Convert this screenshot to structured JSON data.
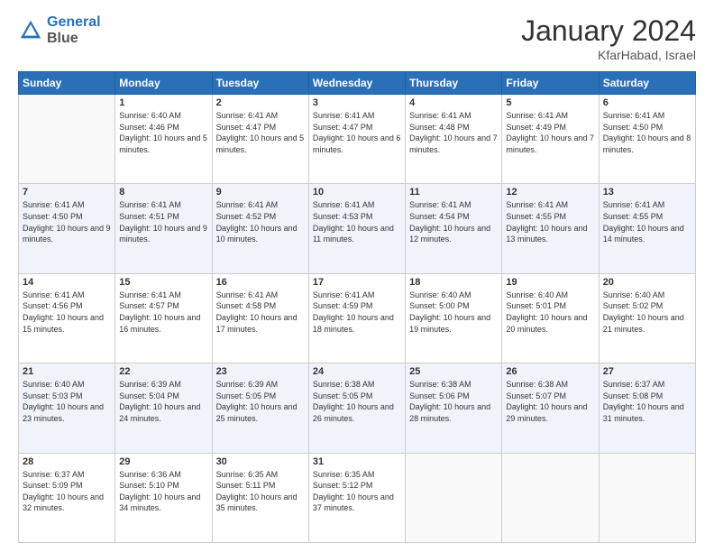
{
  "header": {
    "logo_line1": "General",
    "logo_line2": "Blue",
    "month": "January 2024",
    "location": "KfarHabad, Israel"
  },
  "days_of_week": [
    "Sunday",
    "Monday",
    "Tuesday",
    "Wednesday",
    "Thursday",
    "Friday",
    "Saturday"
  ],
  "weeks": [
    [
      {
        "day": "",
        "sunrise": "",
        "sunset": "",
        "daylight": ""
      },
      {
        "day": "1",
        "sunrise": "6:40 AM",
        "sunset": "4:46 PM",
        "daylight": "10 hours and 5 minutes."
      },
      {
        "day": "2",
        "sunrise": "6:41 AM",
        "sunset": "4:47 PM",
        "daylight": "10 hours and 5 minutes."
      },
      {
        "day": "3",
        "sunrise": "6:41 AM",
        "sunset": "4:47 PM",
        "daylight": "10 hours and 6 minutes."
      },
      {
        "day": "4",
        "sunrise": "6:41 AM",
        "sunset": "4:48 PM",
        "daylight": "10 hours and 7 minutes."
      },
      {
        "day": "5",
        "sunrise": "6:41 AM",
        "sunset": "4:49 PM",
        "daylight": "10 hours and 7 minutes."
      },
      {
        "day": "6",
        "sunrise": "6:41 AM",
        "sunset": "4:50 PM",
        "daylight": "10 hours and 8 minutes."
      }
    ],
    [
      {
        "day": "7",
        "sunrise": "6:41 AM",
        "sunset": "4:50 PM",
        "daylight": "10 hours and 9 minutes."
      },
      {
        "day": "8",
        "sunrise": "6:41 AM",
        "sunset": "4:51 PM",
        "daylight": "10 hours and 9 minutes."
      },
      {
        "day": "9",
        "sunrise": "6:41 AM",
        "sunset": "4:52 PM",
        "daylight": "10 hours and 10 minutes."
      },
      {
        "day": "10",
        "sunrise": "6:41 AM",
        "sunset": "4:53 PM",
        "daylight": "10 hours and 11 minutes."
      },
      {
        "day": "11",
        "sunrise": "6:41 AM",
        "sunset": "4:54 PM",
        "daylight": "10 hours and 12 minutes."
      },
      {
        "day": "12",
        "sunrise": "6:41 AM",
        "sunset": "4:55 PM",
        "daylight": "10 hours and 13 minutes."
      },
      {
        "day": "13",
        "sunrise": "6:41 AM",
        "sunset": "4:55 PM",
        "daylight": "10 hours and 14 minutes."
      }
    ],
    [
      {
        "day": "14",
        "sunrise": "6:41 AM",
        "sunset": "4:56 PM",
        "daylight": "10 hours and 15 minutes."
      },
      {
        "day": "15",
        "sunrise": "6:41 AM",
        "sunset": "4:57 PM",
        "daylight": "10 hours and 16 minutes."
      },
      {
        "day": "16",
        "sunrise": "6:41 AM",
        "sunset": "4:58 PM",
        "daylight": "10 hours and 17 minutes."
      },
      {
        "day": "17",
        "sunrise": "6:41 AM",
        "sunset": "4:59 PM",
        "daylight": "10 hours and 18 minutes."
      },
      {
        "day": "18",
        "sunrise": "6:40 AM",
        "sunset": "5:00 PM",
        "daylight": "10 hours and 19 minutes."
      },
      {
        "day": "19",
        "sunrise": "6:40 AM",
        "sunset": "5:01 PM",
        "daylight": "10 hours and 20 minutes."
      },
      {
        "day": "20",
        "sunrise": "6:40 AM",
        "sunset": "5:02 PM",
        "daylight": "10 hours and 21 minutes."
      }
    ],
    [
      {
        "day": "21",
        "sunrise": "6:40 AM",
        "sunset": "5:03 PM",
        "daylight": "10 hours and 23 minutes."
      },
      {
        "day": "22",
        "sunrise": "6:39 AM",
        "sunset": "5:04 PM",
        "daylight": "10 hours and 24 minutes."
      },
      {
        "day": "23",
        "sunrise": "6:39 AM",
        "sunset": "5:05 PM",
        "daylight": "10 hours and 25 minutes."
      },
      {
        "day": "24",
        "sunrise": "6:38 AM",
        "sunset": "5:05 PM",
        "daylight": "10 hours and 26 minutes."
      },
      {
        "day": "25",
        "sunrise": "6:38 AM",
        "sunset": "5:06 PM",
        "daylight": "10 hours and 28 minutes."
      },
      {
        "day": "26",
        "sunrise": "6:38 AM",
        "sunset": "5:07 PM",
        "daylight": "10 hours and 29 minutes."
      },
      {
        "day": "27",
        "sunrise": "6:37 AM",
        "sunset": "5:08 PM",
        "daylight": "10 hours and 31 minutes."
      }
    ],
    [
      {
        "day": "28",
        "sunrise": "6:37 AM",
        "sunset": "5:09 PM",
        "daylight": "10 hours and 32 minutes."
      },
      {
        "day": "29",
        "sunrise": "6:36 AM",
        "sunset": "5:10 PM",
        "daylight": "10 hours and 34 minutes."
      },
      {
        "day": "30",
        "sunrise": "6:35 AM",
        "sunset": "5:11 PM",
        "daylight": "10 hours and 35 minutes."
      },
      {
        "day": "31",
        "sunrise": "6:35 AM",
        "sunset": "5:12 PM",
        "daylight": "10 hours and 37 minutes."
      },
      {
        "day": "",
        "sunrise": "",
        "sunset": "",
        "daylight": ""
      },
      {
        "day": "",
        "sunrise": "",
        "sunset": "",
        "daylight": ""
      },
      {
        "day": "",
        "sunrise": "",
        "sunset": "",
        "daylight": ""
      }
    ]
  ]
}
